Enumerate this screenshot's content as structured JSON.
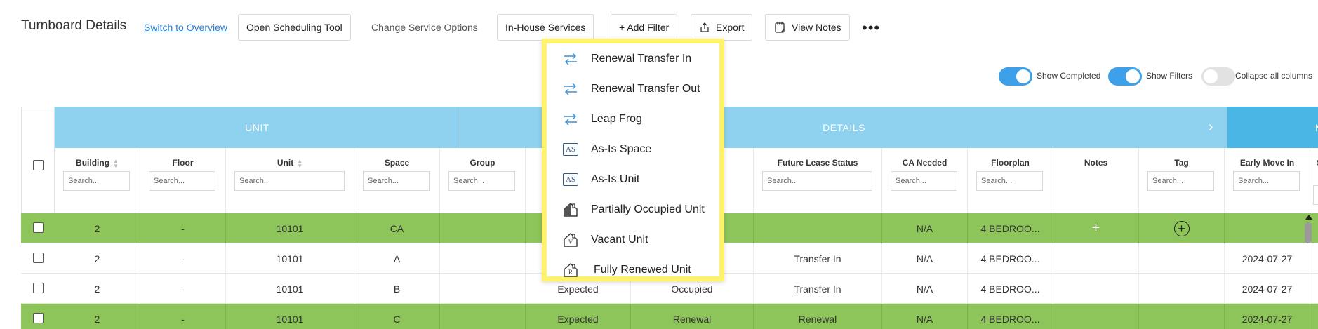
{
  "header": {
    "title": "Turnboard Details",
    "switch_link": "Switch to Overview",
    "open_scheduling": "Open Scheduling Tool",
    "change_service": "Change Service Options",
    "in_house": "In-House Services",
    "add_filter": "+ Add Filter",
    "export": "Export",
    "view_notes": "View Notes",
    "more": "•••"
  },
  "toggles": [
    {
      "label": "Show Completed",
      "on": true
    },
    {
      "label": "Show Filters",
      "on": true
    },
    {
      "label": "Collapse all columns",
      "on": false
    }
  ],
  "groups": {
    "unit": "UNIT",
    "details": "DETAILS",
    "details_arrow": "›",
    "move": "MOV"
  },
  "columns": {
    "building": "Building",
    "floor": "Floor",
    "unit": "Unit",
    "space": "Space",
    "group": "Group",
    "future_lease_status": "Future Lease Status",
    "ca_needed": "CA Needed",
    "floorplan": "Floorplan",
    "notes": "Notes",
    "tag": "Tag",
    "early_move_in": "Early Move In",
    "next_col_partial": "S",
    "next_col_partial2": "M",
    "search_placeholder": "Search...",
    "search_partial": "Search...",
    "search_partial2": "Sea"
  },
  "rows": [
    {
      "building": "2",
      "floor": "-",
      "unit": "10101",
      "space": "CA",
      "c_status": "",
      "c_occ": "",
      "future": "",
      "ca": "N/A",
      "floorplan": "4 BEDROO...",
      "notes": "+",
      "tag": "+",
      "early": "",
      "green": true
    },
    {
      "building": "2",
      "floor": "-",
      "unit": "10101",
      "space": "A",
      "c_status": "",
      "c_occ": "",
      "future": "Transfer In",
      "ca": "N/A",
      "floorplan": "4 BEDROO...",
      "notes": "",
      "tag": "",
      "early": "2024-07-27",
      "green": false
    },
    {
      "building": "2",
      "floor": "-",
      "unit": "10101",
      "space": "B",
      "c_status": "Expected",
      "c_occ": "Occupied",
      "future": "Transfer In",
      "ca": "N/A",
      "floorplan": "4 BEDROO...",
      "notes": "",
      "tag": "",
      "early": "2024-07-27",
      "green": false
    },
    {
      "building": "2",
      "floor": "-",
      "unit": "10101",
      "space": "C",
      "c_status": "Expected",
      "c_occ": "Renewal",
      "future": "Renewal",
      "ca": "N/A",
      "floorplan": "4 BEDROO...",
      "notes": "",
      "tag": "",
      "early": "2024-07-27",
      "green": true
    }
  ],
  "dropdown": {
    "items": [
      {
        "label": "Renewal Transfer In",
        "icon": "transfer-arrows-icon"
      },
      {
        "label": "Renewal Transfer Out",
        "icon": "transfer-arrows-icon"
      },
      {
        "label": "Leap Frog",
        "icon": "transfer-arrows-icon"
      },
      {
        "label": "As-Is Space",
        "icon": "as-is-badge-icon",
        "badge": "AS"
      },
      {
        "label": "As-Is Unit",
        "icon": "as-is-badge-icon",
        "badge": "AS"
      },
      {
        "label": "Partially Occupied Unit",
        "icon": "house-half-icon"
      },
      {
        "label": "Vacant Unit",
        "icon": "house-v-icon",
        "badge": "V"
      },
      {
        "label": "Fully Renewed Unit",
        "icon": "house-r-icon",
        "badge": "R"
      }
    ]
  },
  "colors": {
    "accent": "#3ea0e8",
    "group_header": "#8fd2ef",
    "row_green": "#8dc55a",
    "highlight": "#fff36b",
    "link": "#2f7fd1"
  }
}
